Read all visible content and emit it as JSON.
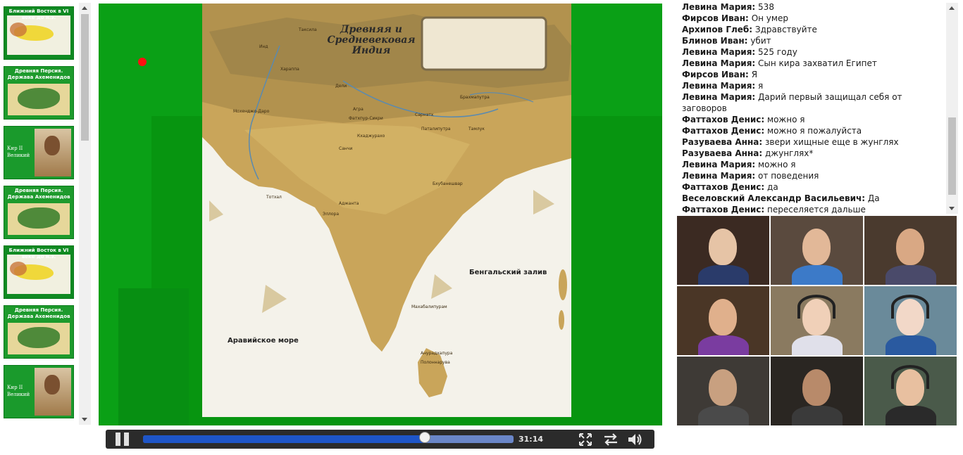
{
  "thumbnails": [
    {
      "type": "map",
      "title": "Ближний Восток в VI веке до н.э."
    },
    {
      "type": "persia",
      "title": "Древняя Персия. Держава Ахеменидов"
    },
    {
      "type": "kir",
      "title": "Кир II Великий"
    },
    {
      "type": "persia",
      "title": "Древняя Персия. Держава Ахеменидов"
    },
    {
      "type": "map",
      "title": "Ближний Восток в VI веке до н.э."
    },
    {
      "type": "persia",
      "title": "Древняя Персия. Держава Ахеменидов"
    },
    {
      "type": "kir",
      "title": "Кир II Великий"
    }
  ],
  "slide": {
    "map_title": "Древняя и Средневековая Индия",
    "labels": {
      "bay": "Бенгальский залив",
      "sea": "Аравийское море"
    },
    "cities": [
      {
        "name": "Таксила"
      },
      {
        "name": "Инд"
      },
      {
        "name": "Хараппа"
      },
      {
        "name": "Дели"
      },
      {
        "name": "Мохенджо-Даро"
      },
      {
        "name": "Агра"
      },
      {
        "name": "Фатхпур-Сикри"
      },
      {
        "name": "Сарнатх"
      },
      {
        "name": "Паталипутра"
      },
      {
        "name": "Брахмапутра"
      },
      {
        "name": "Кхаджурахо"
      },
      {
        "name": "Тамлук"
      },
      {
        "name": "Санчи"
      },
      {
        "name": "Бхубанешвар"
      },
      {
        "name": "Тотхал"
      },
      {
        "name": "Аджанта"
      },
      {
        "name": "Эллора"
      },
      {
        "name": "Махабалипурам"
      },
      {
        "name": "Анурадхапура"
      },
      {
        "name": "Полоннарува"
      }
    ]
  },
  "player": {
    "time": "31:14",
    "progress": 0.76,
    "buttons": [
      "pause",
      "fullscreen",
      "swap",
      "volume"
    ]
  },
  "chat": {
    "messages": [
      {
        "author": "Левина Мария:",
        "text": "538"
      },
      {
        "author": "Фирсов Иван:",
        "text": "Он умер"
      },
      {
        "author": "Архипов Глеб:",
        "text": "Здравствуйте"
      },
      {
        "author": "Блинов Иван:",
        "text": "убит"
      },
      {
        "author": "Левина Мария:",
        "text": "525 году"
      },
      {
        "author": "Левина Мария:",
        "text": "Сын кира захватил Египет"
      },
      {
        "author": "Фирсов Иван:",
        "text": "Я"
      },
      {
        "author": "Левина Мария:",
        "text": "я"
      },
      {
        "author": "Левина Мария:",
        "text": "Дарий первый защищал себя от заговоров"
      },
      {
        "author": "Фаттахов Денис:",
        "text": "можно я"
      },
      {
        "author": "Фаттахов Денис:",
        "text": "можно я пожалуйста"
      },
      {
        "author": "Разуваева Анна:",
        "text": "звери хищные еще в жунглях"
      },
      {
        "author": "Разуваева Анна:",
        "text": "джунглях*"
      },
      {
        "author": "Левина Мария:",
        "text": "можно я"
      },
      {
        "author": "Левина Мария:",
        "text": "от поведения"
      },
      {
        "author": "Фаттахов Денис:",
        "text": "да"
      },
      {
        "author": "Веселовский Александр Васильевич:",
        "text": "Да"
      },
      {
        "author": "Фаттахов Денис:",
        "text": "переселяется дальше"
      }
    ]
  },
  "colors": {
    "stage_green": "#0aa016",
    "player_bg": "#2b2b2b",
    "progress_blue": "#1e55c7",
    "laser": "#ff1010"
  }
}
